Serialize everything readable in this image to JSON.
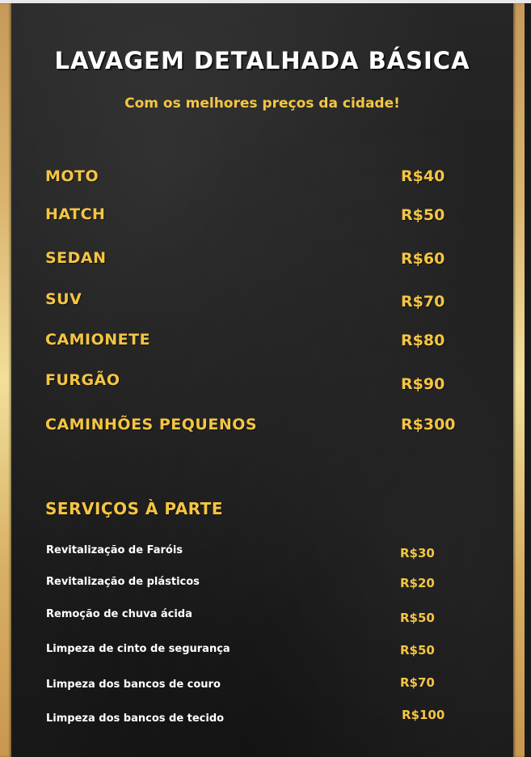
{
  "title": "LAVAGEM DETALHADA BÁSICA",
  "subtitle": "Com os melhores preços da cidade!",
  "main_services": [
    {
      "name": "MOTO",
      "price": "R$40"
    },
    {
      "name": "HATCH",
      "price": "R$50"
    },
    {
      "name": "SEDAN",
      "price": "R$60"
    },
    {
      "name": "SUV",
      "price": "R$70"
    },
    {
      "name": "CAMIONETE",
      "price": "R$80"
    },
    {
      "name": "FURGÃO",
      "price": "R$90"
    },
    {
      "name": "CAMINHÕES PEQUENOS",
      "price": "R$300"
    }
  ],
  "extras": {
    "heading": "SERVIÇOS À PARTE",
    "items": [
      {
        "name": "Revitalização de Faróis",
        "price": "R$30"
      },
      {
        "name": "Revitalização de plásticos",
        "price": "R$20"
      },
      {
        "name": "Remoção de chuva ácida",
        "price": "R$50"
      },
      {
        "name": "Limpeza de cinto de segurança",
        "price": "R$50"
      },
      {
        "name": "Limpeza dos bancos de couro",
        "price": "R$70"
      },
      {
        "name": "Limpeza dos bancos de tecido",
        "price": "R$100"
      }
    ]
  },
  "colors": {
    "background": "#1d1d1d",
    "accent_gold": "#f5c542",
    "frame_gold": "#d9b26d",
    "text_white": "#ffffff"
  }
}
